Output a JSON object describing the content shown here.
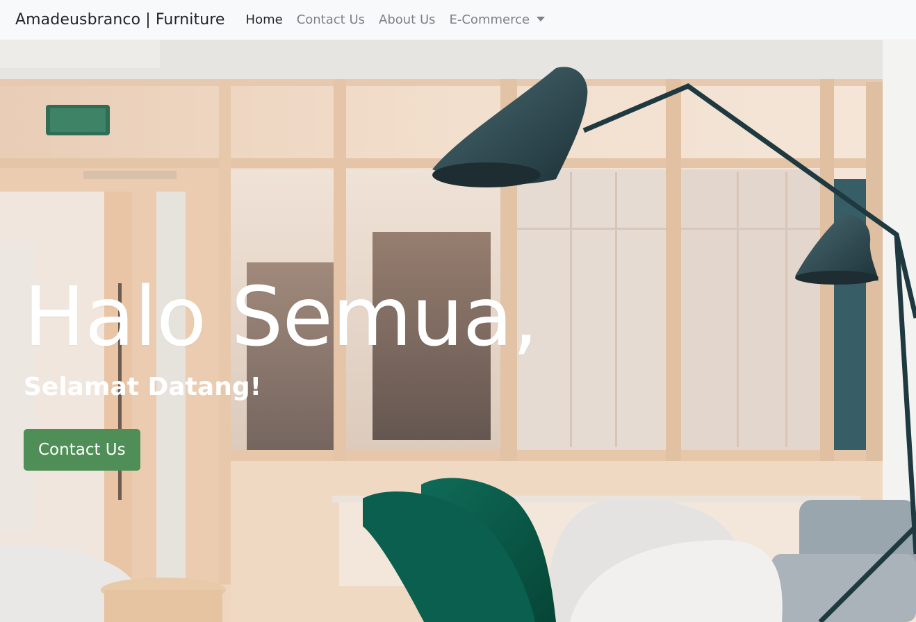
{
  "navbar": {
    "brand": "Amadeusbranco | Furniture",
    "links": [
      {
        "label": "Home",
        "active": true
      },
      {
        "label": "Contact Us"
      },
      {
        "label": "About Us"
      },
      {
        "label": "E-Commerce",
        "dropdown": true
      }
    ]
  },
  "hero": {
    "title": "Halo Semua,",
    "subtitle": "Selamat Datang!",
    "cta_label": "Contact Us",
    "cta_color": "#4f8f57"
  },
  "colors": {
    "navbar_bg": "#f8f9fa",
    "brand_text": "#212529",
    "nav_muted": "#7b8186"
  }
}
